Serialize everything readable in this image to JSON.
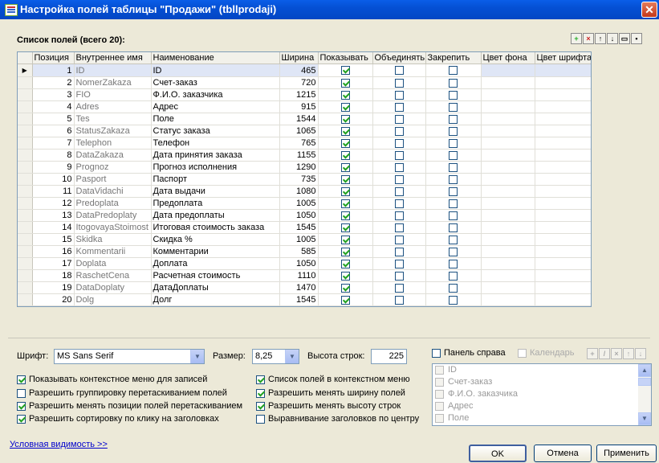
{
  "window": {
    "title": "Настройка полей таблицы \"Продажи\" (tbllprodaji)",
    "close_label": "✕"
  },
  "panel": {
    "label": "Список полей (всего 20):"
  },
  "toolbar": {
    "add": "+",
    "delete": "×",
    "up": "↑",
    "down": "↓",
    "open": "▭",
    "save": "▪"
  },
  "columns": {
    "position": "Позиция",
    "internal": "Внутреннее имя",
    "name": "Наименование",
    "width": "Ширина",
    "show": "Показывать",
    "merge": "Объединять",
    "pin": "Закрепить",
    "bg": "Цвет фона",
    "fg": "Цвет шрифта"
  },
  "rows": [
    {
      "pos": "1",
      "int": "ID",
      "name": "ID",
      "width": "465",
      "show": true
    },
    {
      "pos": "2",
      "int": "NomerZakaza",
      "name": "Счет-заказ",
      "width": "720",
      "show": true
    },
    {
      "pos": "3",
      "int": "FIO",
      "name": "Ф.И.О. заказчика",
      "width": "1215",
      "show": true
    },
    {
      "pos": "4",
      "int": "Adres",
      "name": "Адрес",
      "width": "915",
      "show": true
    },
    {
      "pos": "5",
      "int": "Tes",
      "name": "Поле",
      "width": "1544",
      "show": true
    },
    {
      "pos": "6",
      "int": "StatusZakaza",
      "name": "Статус заказа",
      "width": "1065",
      "show": true
    },
    {
      "pos": "7",
      "int": "Telephon",
      "name": "Телефон",
      "width": "765",
      "show": true
    },
    {
      "pos": "8",
      "int": "DataZakaza",
      "name": "Дата принятия заказа",
      "width": "1155",
      "show": true
    },
    {
      "pos": "9",
      "int": "Prognoz",
      "name": "Прогноз исполнения",
      "width": "1290",
      "show": true
    },
    {
      "pos": "10",
      "int": "Pasport",
      "name": "Паспорт",
      "width": "735",
      "show": true
    },
    {
      "pos": "11",
      "int": "DataVidachi",
      "name": "Дата выдачи",
      "width": "1080",
      "show": true
    },
    {
      "pos": "12",
      "int": "Predoplata",
      "name": "Предоплата",
      "width": "1005",
      "show": true
    },
    {
      "pos": "13",
      "int": "DataPredoplaty",
      "name": "Дата предоплаты",
      "width": "1050",
      "show": true
    },
    {
      "pos": "14",
      "int": "ItogovayaStoimost",
      "name": "Итоговая стоимость заказа",
      "width": "1545",
      "show": true
    },
    {
      "pos": "15",
      "int": "Skidka",
      "name": "Скидка %",
      "width": "1005",
      "show": true
    },
    {
      "pos": "16",
      "int": "Kommentarii",
      "name": "Комментарии",
      "width": "585",
      "show": true
    },
    {
      "pos": "17",
      "int": "Doplata",
      "name": "Доплата",
      "width": "1050",
      "show": true
    },
    {
      "pos": "18",
      "int": "RaschetCena",
      "name": "Расчетная стоимость",
      "width": "1110",
      "show": true
    },
    {
      "pos": "19",
      "int": "DataDoplaty",
      "name": "ДатаДоплаты",
      "width": "1470",
      "show": true
    },
    {
      "pos": "20",
      "int": "Dolg",
      "name": "Долг",
      "width": "1545",
      "show": true
    }
  ],
  "font": {
    "label": "Шрифт:",
    "value": "MS Sans Serif"
  },
  "size": {
    "label": "Размер:",
    "value": "8,25"
  },
  "row_height": {
    "label": "Высота строк:",
    "value": "225"
  },
  "right_panel": {
    "label": "Панель справа",
    "calendar": "Календарь",
    "items": [
      "ID",
      "Счет-заказ",
      "Ф.И.О. заказчика",
      "Адрес",
      "Поле"
    ]
  },
  "options": {
    "ctx_menu": "Показывать контекстное меню для записей",
    "group_drag": "Разрешить группировку перетаскиванием полей",
    "reorder": "Разрешить менять позиции полей перетаскиванием",
    "sort_click": "Разрешить сортировку по клику на заголовках",
    "fields_ctx": "Список полей в контекстном меню",
    "col_width": "Разрешить менять ширину полей",
    "row_h": "Разрешить менять высоту строк",
    "align_center": "Выравнивание заголовков по центру"
  },
  "link": "Условная видимость >>",
  "buttons": {
    "ok": "OK",
    "cancel": "Отмена",
    "apply": "Применить"
  }
}
